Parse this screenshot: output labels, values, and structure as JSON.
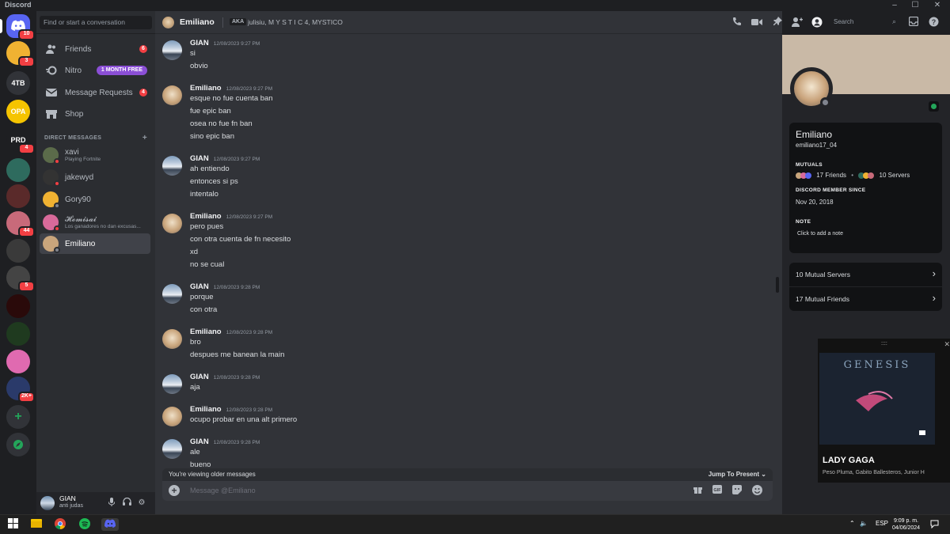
{
  "window": {
    "title": "Discord"
  },
  "rail": {
    "servers": [
      {
        "label": "",
        "badge": "10",
        "color": "#5865f2"
      },
      {
        "label": "",
        "badge": "3",
        "color": "#f0b232"
      },
      {
        "label": "4TB",
        "badge": "",
        "color": "#313338"
      },
      {
        "label": "OPA",
        "badge": "",
        "color": "#f5c400"
      },
      {
        "label": "PRD",
        "badge": "4",
        "color": "#1e1f22"
      },
      {
        "label": "",
        "badge": "",
        "color": "#2e6b5e"
      },
      {
        "label": "",
        "badge": "",
        "color": "#5a2a2a"
      },
      {
        "label": "",
        "badge": "44",
        "color": "#c86a7a"
      },
      {
        "label": "",
        "badge": "",
        "color": "#3a3a3a"
      },
      {
        "label": "",
        "badge": "5",
        "color": "#444"
      },
      {
        "label": "",
        "badge": "",
        "color": "#2a0a0a"
      },
      {
        "label": "",
        "badge": "",
        "color": "#1f3a1f"
      },
      {
        "label": "",
        "badge": "",
        "color": "#e06ab0"
      },
      {
        "label": "",
        "badge": "2K+",
        "color": "#2a3a6a"
      }
    ]
  },
  "sidebar": {
    "search_placeholder": "Find or start a conversation",
    "nav": [
      {
        "label": "Friends",
        "badge": "6"
      },
      {
        "label": "Nitro",
        "pill": "1 MONTH FREE"
      },
      {
        "label": "Message Requests",
        "badge": "4"
      },
      {
        "label": "Shop"
      }
    ],
    "dm_header": "DIRECT MESSAGES",
    "dms": [
      {
        "name": "xavi",
        "sub": "Playing Fortnite",
        "status": "#f23f43",
        "color": "#5b6b4a"
      },
      {
        "name": "jakewyd",
        "sub": "",
        "status": "#f23f43",
        "color": "#333"
      },
      {
        "name": "Gory90",
        "sub": "",
        "status": "#80848e",
        "color": "#f0b232"
      },
      {
        "name": "𝓗𝓸𝓶𝓲𝓼𝓪𝓲",
        "sub": "Los ganadores no dan excusas...",
        "status": "#f23f43",
        "color": "#d86a9a"
      },
      {
        "name": "Emiliano",
        "sub": "",
        "status": "#80848e",
        "color": "#c9a57c"
      }
    ],
    "user": {
      "name": "GIAN",
      "status": "anti judas"
    }
  },
  "chat": {
    "recipient": "Emiliano",
    "aka_label": "AKA",
    "aka_names": "julisiu, M Y S T I C 4, MYSTICO",
    "search_placeholder": "Search",
    "messages": [
      {
        "author": "GIAN",
        "time": "12/08/2023 9:27 PM",
        "lines": [
          "si",
          "obvio"
        ]
      },
      {
        "author": "Emiliano",
        "time": "12/08/2023 9:27 PM",
        "lines": [
          "esque no fue cuenta ban",
          "fue epic ban",
          "osea no fue fn ban",
          "sino epic ban"
        ]
      },
      {
        "author": "GIAN",
        "time": "12/08/2023 9:27 PM",
        "lines": [
          "ah entiendo",
          "entonces si ps",
          "intentalo"
        ]
      },
      {
        "author": "Emiliano",
        "time": "12/08/2023 9:27 PM",
        "lines": [
          "pero pues",
          "con otra cuenta de fn necesito",
          "xd",
          "no se cual"
        ]
      },
      {
        "author": "GIAN",
        "time": "12/08/2023 9:28 PM",
        "lines": [
          "porque",
          "con otra"
        ]
      },
      {
        "author": "Emiliano",
        "time": "12/08/2023 9:28 PM",
        "lines": [
          "bro",
          "despues me banean la main"
        ]
      },
      {
        "author": "GIAN",
        "time": "12/08/2023 9:28 PM",
        "lines": [
          "aja"
        ]
      },
      {
        "author": "Emiliano",
        "time": "12/08/2023 9:28 PM",
        "lines": [
          "ocupo probar en una alt primero"
        ]
      },
      {
        "author": "GIAN",
        "time": "12/08/2023 9:28 PM",
        "lines": [
          "ale",
          "bueno"
        ]
      }
    ],
    "older_notice": "You're viewing older messages",
    "jump_label": "Jump To Present",
    "composer_placeholder": "Message @Emiliano"
  },
  "profile": {
    "display_name": "Emiliano",
    "username": "emiliano17_04",
    "mutuals_label": "MUTUALS",
    "mutual_friends_short": "17 Friends",
    "mutual_servers_short": "10 Servers",
    "member_since_label": "DISCORD MEMBER SINCE",
    "member_since": "Nov 20, 2018",
    "note_label": "NOTE",
    "note_placeholder": "Click to add a note",
    "rows": [
      "10 Mutual Servers",
      "17 Mutual Friends"
    ]
  },
  "spotify": {
    "cover_title": "GENESIS",
    "song": "LADY GAGA",
    "artists": "Peso Pluma, Gabito Ballesteros, Junior H"
  },
  "taskbar": {
    "lang": "ESP",
    "time": "9:09 p. m.",
    "date": "04/06/2024"
  }
}
